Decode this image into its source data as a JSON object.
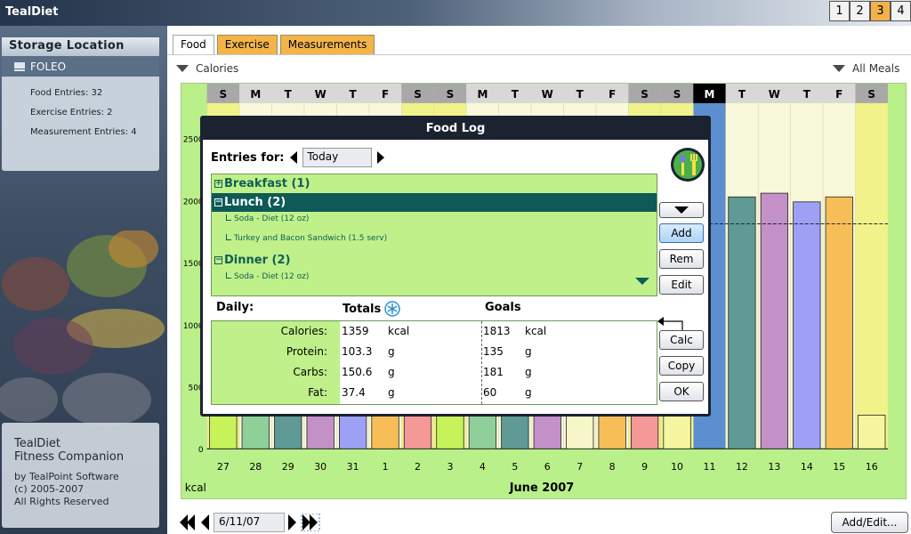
{
  "app": {
    "title": "TealDiet"
  },
  "pages": [
    "1",
    "2",
    "3",
    "4"
  ],
  "active_page": "3",
  "sidebar": {
    "storage_header": "Storage Location",
    "location": "FOLEO",
    "stats": [
      "Food Entries: 32",
      "Exercise Entries: 2",
      "Measurement Entries: 4"
    ],
    "about": {
      "line1": "TealDiet",
      "line2": "Fitness Companion",
      "line3": "by TealPoint Software",
      "line4": "(c) 2005-2007",
      "line5": "All Rights Reserved"
    }
  },
  "tabs": [
    "Food",
    "Exercise",
    "Measurements"
  ],
  "active_tab": "Food",
  "view_dropdown": "Calories",
  "meal_dropdown": "All Meals",
  "chart_data": {
    "type": "bar",
    "ylabel": "kcal",
    "xlabel": "June 2007",
    "yticks": [
      0,
      500,
      1000,
      1500,
      2000,
      2500
    ],
    "ylim": [
      0,
      2800
    ],
    "goal_line": 1813,
    "weekdays": [
      "S",
      "M",
      "T",
      "W",
      "T",
      "F",
      "S",
      "S",
      "M",
      "T",
      "W",
      "T",
      "F",
      "S",
      "S",
      "M",
      "T",
      "W",
      "T",
      "F",
      "S"
    ],
    "days": [
      "27",
      "28",
      "29",
      "30",
      "31",
      "1",
      "2",
      "3",
      "4",
      "5",
      "6",
      "7",
      "8",
      "9",
      "10",
      "11",
      "12",
      "13",
      "14",
      "15",
      "16"
    ],
    "highlight_day": "11",
    "values": [
      null,
      null,
      null,
      null,
      null,
      null,
      null,
      null,
      null,
      null,
      null,
      null,
      null,
      null,
      null,
      null,
      2030,
      2060,
      1990,
      2030,
      null
    ],
    "bar_colors": [
      "#c8f25a",
      "#8fcf9a",
      "#5f9a94",
      "#c490c8",
      "#9da0f4",
      "#f7be58",
      "#f49898",
      "#c8f25a",
      "#8fcf9a",
      "#5f9a94",
      "#c490c8",
      "#f6f6c8",
      "#f7be58",
      "#f49898",
      "#f6f6a0",
      "#5b8fd0",
      "#5f9a94",
      "#c490c8",
      "#9da0f4",
      "#f7be58",
      "#f6f6a0"
    ]
  },
  "bottom": {
    "date": "6/11/07",
    "add_edit": "Add/Edit..."
  },
  "dialog": {
    "title": "Food Log",
    "entries_label": "Entries for:",
    "entries_value": "Today",
    "groups": [
      {
        "label": "Breakfast (1)",
        "expanded": false,
        "items": []
      },
      {
        "label": "Lunch (2)",
        "expanded": true,
        "items": [
          "Soda - Diet (12 oz)",
          "Turkey and Bacon Sandwich (1.5 serv)"
        ]
      },
      {
        "label": "Dinner (2)",
        "expanded": true,
        "items": [
          "Soda - Diet (12 oz)"
        ]
      }
    ],
    "buttons": {
      "add": "Add",
      "rem": "Rem",
      "edit": "Edit",
      "calc": "Calc",
      "copy": "Copy",
      "ok": "OK"
    },
    "daily_label": "Daily:",
    "totals_label": "Totals",
    "goals_label": "Goals",
    "rows": [
      {
        "label": "Calories:",
        "total": "1359",
        "total_unit": "kcal",
        "goal": "1813",
        "goal_unit": "kcal"
      },
      {
        "label": "Protein:",
        "total": "103.3",
        "total_unit": "g",
        "goal": "135",
        "goal_unit": "g"
      },
      {
        "label": "Carbs:",
        "total": "150.6",
        "total_unit": "g",
        "goal": "181",
        "goal_unit": "g"
      },
      {
        "label": "Fat:",
        "total": "37.4",
        "total_unit": "g",
        "goal": "60",
        "goal_unit": "g"
      }
    ]
  }
}
